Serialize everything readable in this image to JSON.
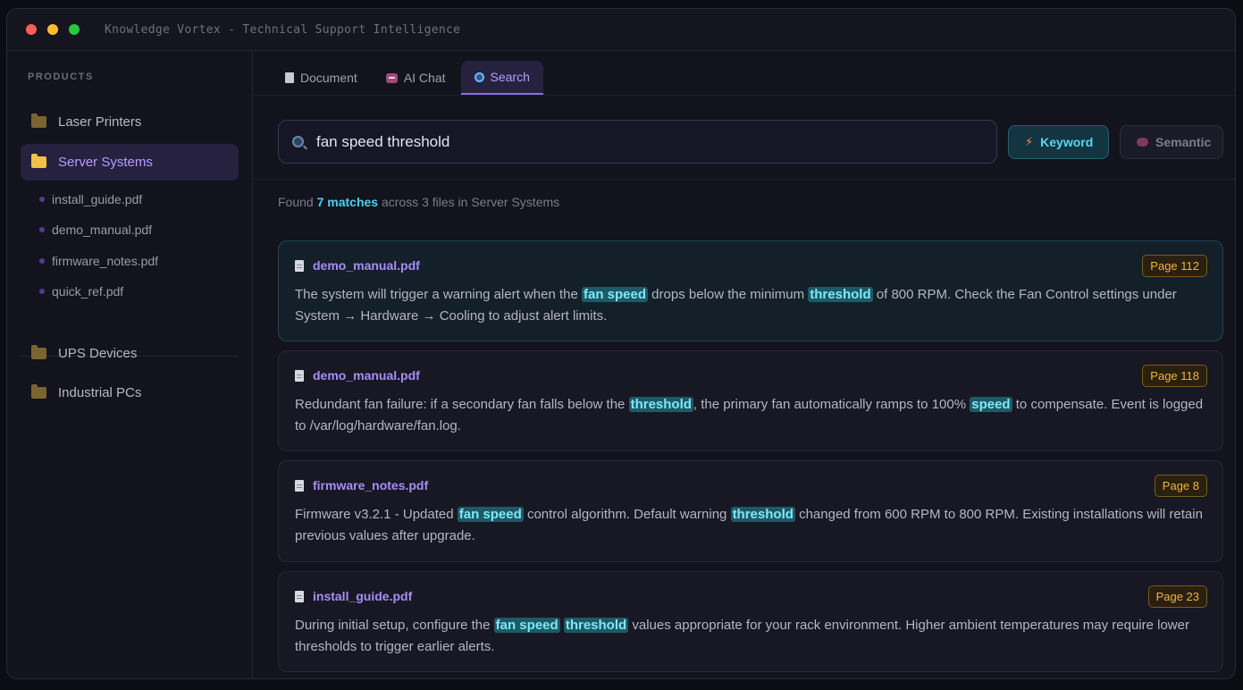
{
  "window": {
    "title": "Knowledge Vortex - Technical Support Intelligence"
  },
  "sidebar": {
    "heading": "PRODUCTS",
    "folders": [
      {
        "label": "Laser Printers",
        "active": false
      },
      {
        "label": "Server Systems",
        "active": true
      },
      {
        "label": "UPS Devices",
        "active": false
      },
      {
        "label": "Industrial PCs",
        "active": false
      }
    ],
    "files": [
      "install_guide.pdf",
      "demo_manual.pdf",
      "firmware_notes.pdf",
      "quick_ref.pdf"
    ]
  },
  "tabs": [
    {
      "label": "Document",
      "icon": "document-icon"
    },
    {
      "label": "AI Chat",
      "icon": "robot-icon"
    },
    {
      "label": "Search",
      "icon": "magnifier-icon",
      "active": true
    }
  ],
  "search": {
    "query": "fan speed threshold",
    "modes": {
      "keyword": "Keyword",
      "semantic": "Semantic"
    },
    "active_mode": "keyword"
  },
  "summary": {
    "prefix": "Found",
    "count": "7 matches",
    "suffix": "across 3 files in Server Systems"
  },
  "results": [
    {
      "file": "demo_manual.pdf",
      "page": "Page 112",
      "segments": [
        {
          "t": "The system will trigger a warning alert when the "
        },
        {
          "t": "fan speed",
          "hl": true
        },
        {
          "t": " drops below the minimum "
        },
        {
          "t": "threshold",
          "hl": true
        },
        {
          "t": " of 800 RPM. Check the Fan Control settings under System → Hardware → Cooling to adjust alert limits."
        }
      ]
    },
    {
      "file": "demo_manual.pdf",
      "page": "Page 118",
      "segments": [
        {
          "t": "Redundant fan failure: if a secondary fan falls below the "
        },
        {
          "t": "threshold",
          "hl": true
        },
        {
          "t": ", the primary fan automatically ramps to 100% "
        },
        {
          "t": "speed",
          "hl": true
        },
        {
          "t": " to compensate. Event is logged to /var/log/hardware/fan.log."
        }
      ]
    },
    {
      "file": "firmware_notes.pdf",
      "page": "Page 8",
      "segments": [
        {
          "t": "Firmware v3.2.1 - Updated "
        },
        {
          "t": "fan speed",
          "hl": true
        },
        {
          "t": " control algorithm. Default warning "
        },
        {
          "t": "threshold",
          "hl": true
        },
        {
          "t": " changed from 600 RPM to 800 RPM. Existing installations will retain previous values after upgrade."
        }
      ]
    },
    {
      "file": "install_guide.pdf",
      "page": "Page 23",
      "segments": [
        {
          "t": "During initial setup, configure the "
        },
        {
          "t": "fan speed",
          "hl": true
        },
        {
          "t": " "
        },
        {
          "t": "threshold",
          "hl": true
        },
        {
          "t": " values appropriate for your rack environment. Higher ambient temperatures may require lower thresholds to trigger earlier alerts."
        }
      ]
    }
  ]
}
